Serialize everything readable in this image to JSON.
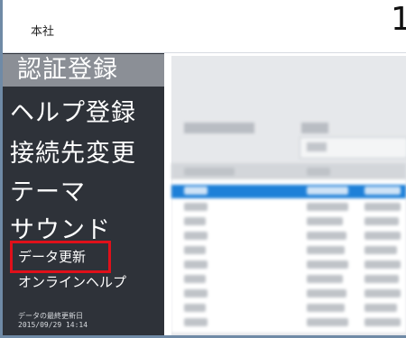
{
  "header": {
    "office_name": "本社",
    "big_number": "1"
  },
  "sidebar": {
    "menu": [
      {
        "label": "認証登録",
        "active": true
      },
      {
        "label": "ヘルプ登録"
      },
      {
        "label": "接続先変更"
      },
      {
        "label": "テーマ"
      },
      {
        "label": "サウンド"
      }
    ],
    "data_update_label": "データ更新",
    "online_help_label": "オンラインヘルプ",
    "last_update_label": "データの最終更新日",
    "last_update_value": "2015/09/29 14:14"
  },
  "colors": {
    "sidebar_bg": "#2e3239",
    "active_item_bg": "#8b8f96",
    "highlight_border": "#e0101a",
    "selected_row": "#1e80d8"
  }
}
